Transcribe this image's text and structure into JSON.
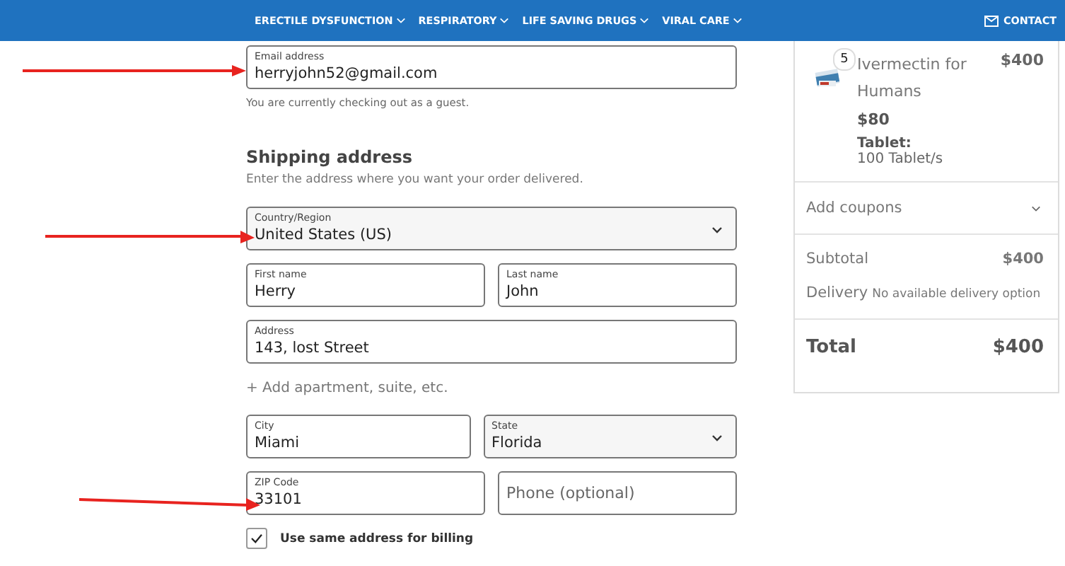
{
  "nav": {
    "items": [
      {
        "label": "ERECTILE DYSFUNCTION"
      },
      {
        "label": "RESPIRATORY"
      },
      {
        "label": "LIFE SAVING DRUGS"
      },
      {
        "label": "VIRAL CARE"
      }
    ],
    "contact": "CONTACT"
  },
  "form": {
    "email": {
      "label": "Email address",
      "value": "herryjohn52@gmail.com"
    },
    "guest_note": "You are currently checking out as a guest.",
    "heading": "Shipping address",
    "subheading": "Enter the address where you want your order delivered.",
    "rows": [
      [
        {
          "kind": "select",
          "label": "Country/Region",
          "value": "United States (US)"
        }
      ],
      [
        {
          "kind": "text",
          "label": "First name",
          "value": "Herry"
        },
        {
          "kind": "text",
          "label": "Last name",
          "value": "John"
        }
      ],
      [
        {
          "kind": "text",
          "label": "Address",
          "value": "143, lost Street"
        }
      ],
      [
        {
          "kind": "link",
          "label": "+ Add apartment, suite, etc."
        }
      ],
      [
        {
          "kind": "text",
          "label": "City",
          "value": "Miami"
        },
        {
          "kind": "select",
          "label": "State",
          "value": "Florida"
        }
      ],
      [
        {
          "kind": "text",
          "label": "ZIP Code",
          "value": "33101"
        },
        {
          "kind": "text",
          "placeholder": "Phone (optional)"
        }
      ]
    ],
    "billing": {
      "label": "Use same address for billing",
      "checked": true
    }
  },
  "summary": {
    "product": {
      "quantity": "5",
      "name": "Ivermectin for Humans",
      "line_total": "$400",
      "price": "$80",
      "attribute_label": "Tablet:",
      "attribute_value": "100 Tablet/s"
    },
    "coupons": {
      "label": "Add coupons",
      "expanded": false
    },
    "subtotal": {
      "label": "Subtotal",
      "value": "$400"
    },
    "delivery": {
      "label": "Delivery",
      "value": "No available delivery option"
    },
    "total": {
      "label": "Total",
      "value": "$400"
    }
  }
}
